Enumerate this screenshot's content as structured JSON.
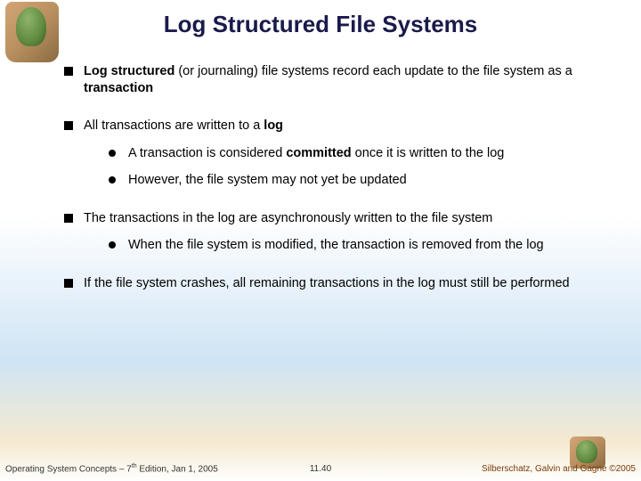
{
  "title": "Log Structured File Systems",
  "bullets": {
    "b1_pre": "Log structured",
    "b1_mid": " (or journaling) file systems record each update to the file system as a ",
    "b1_bold2": "transaction",
    "b2_pre": "All transactions are written to a ",
    "b2_bold": "log",
    "b2_s1_pre": " A transaction is considered ",
    "b2_s1_bold": "committed",
    "b2_s1_post": " once it is written to the log",
    "b2_s2": "However, the file system may not yet be updated",
    "b3": "The transactions in the log are asynchronously written to the file system",
    "b3_s1": " When the file system is modified, the transaction is removed from the log",
    "b4": "If the file system crashes, all remaining transactions in the log must still be performed"
  },
  "footer": {
    "left_pre": "Operating System Concepts – 7",
    "left_sup": "th",
    "left_post": " Edition, Jan 1, 2005",
    "mid": "11.40",
    "right": "Silberschatz, Galvin and Gagne ©2005"
  }
}
